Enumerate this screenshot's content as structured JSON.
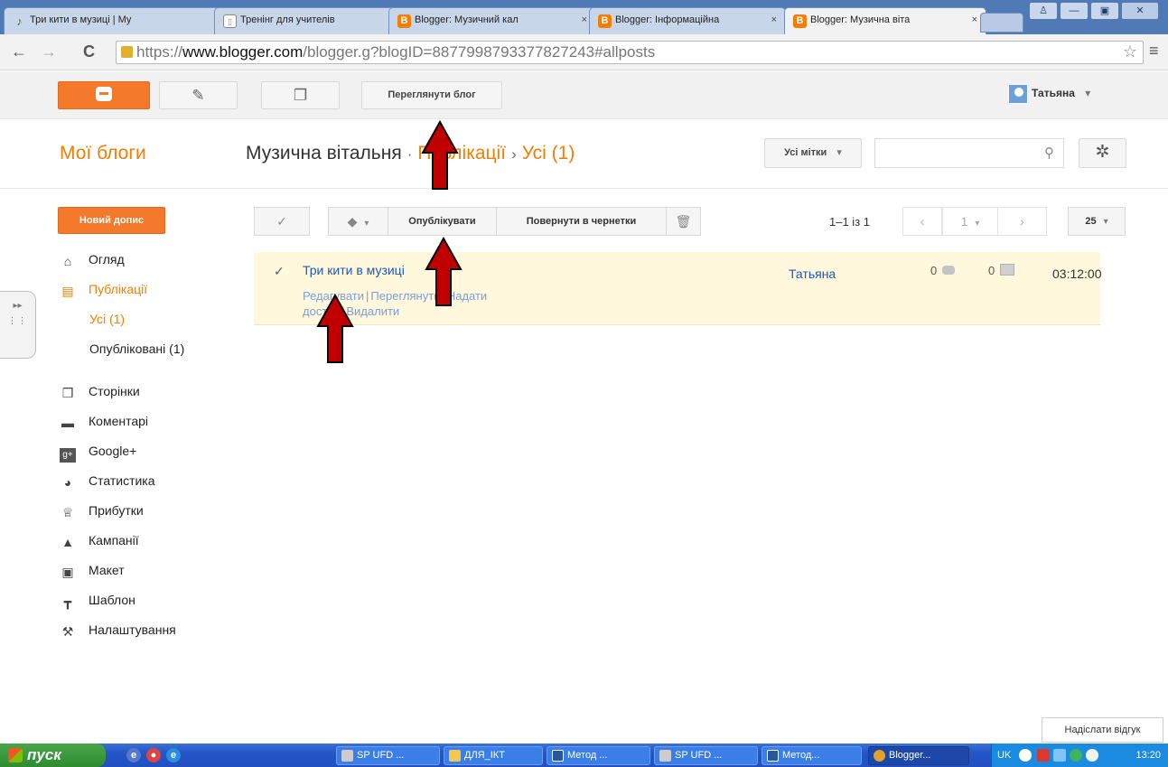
{
  "browser": {
    "tabs": [
      {
        "label": "Три кити в музиці | Му",
        "icon": "note-icon"
      },
      {
        "label": "Тренінг для учителів",
        "icon": "doc-icon"
      },
      {
        "label": "Blogger: Музичний кал",
        "icon": "blogger-icon"
      },
      {
        "label": "Blogger: Інформаційна",
        "icon": "blogger-icon"
      },
      {
        "label": "Blogger: Музична віта",
        "icon": "blogger-icon"
      }
    ],
    "close_glyph": "×",
    "url_prefix": "https://",
    "url_domain": "www.blogger.com",
    "url_path": "/blogger.g?blogID=8877998793377827243#allposts"
  },
  "header": {
    "view_blog_label": "Переглянути блог",
    "user_name": "Татьяна"
  },
  "title_row": {
    "my_blogs": "Мої блоги",
    "blog_name": "Музична вітальня",
    "section": "Публікації",
    "subsection": "Усі (1)",
    "labels_button": "Усі мітки"
  },
  "sidebar": {
    "new_post": "Новий допис",
    "items": [
      {
        "label": "Огляд",
        "icon": "house-icon"
      },
      {
        "label": "Публікації",
        "icon": "posts-icon"
      },
      {
        "label": "Усі (1)"
      },
      {
        "label": "Опубліковані (1)"
      },
      {
        "label": "Сторінки",
        "icon": "pages-icon"
      },
      {
        "label": "Коментарі",
        "icon": "comment-icon"
      },
      {
        "label": "Google+",
        "icon": "google-plus-icon"
      },
      {
        "label": "Статистика",
        "icon": "pie-chart-icon"
      },
      {
        "label": "Прибутки",
        "icon": "trophy-icon"
      },
      {
        "label": "Кампанії",
        "icon": "adwords-icon"
      },
      {
        "label": "Макет",
        "icon": "layout-icon"
      },
      {
        "label": "Шаблон",
        "icon": "paint-roller-icon"
      },
      {
        "label": "Налаштування",
        "icon": "wrench-icon"
      }
    ]
  },
  "actions": {
    "publish": "Опублікувати",
    "revert": "Повернути в чернетки",
    "range": "1–1 із 1",
    "page": "1",
    "per_page": "25"
  },
  "post": {
    "title": "Три кити в музиці",
    "edit": "Редагувати",
    "view": "Переглянути",
    "share_a": "Надати",
    "share_b": "доступ",
    "delete": "Видалити",
    "author": "Татьяна",
    "comments": "0",
    "views": "0",
    "time": "03:12:00"
  },
  "feedback": "Надіслати відгук",
  "taskbar": {
    "start": "пуск",
    "tasks": [
      "SP UFD ...",
      "ДЛЯ_ІКТ",
      "Метод ...",
      "SP UFD ...",
      "Метод...",
      "Blogger..."
    ],
    "lang": "UK",
    "clock": "13:20"
  },
  "colors": {
    "accent": "#f57d00",
    "link": "#1c58b8",
    "row_highlight": "#fff8dc",
    "arrow": "#c00000"
  }
}
